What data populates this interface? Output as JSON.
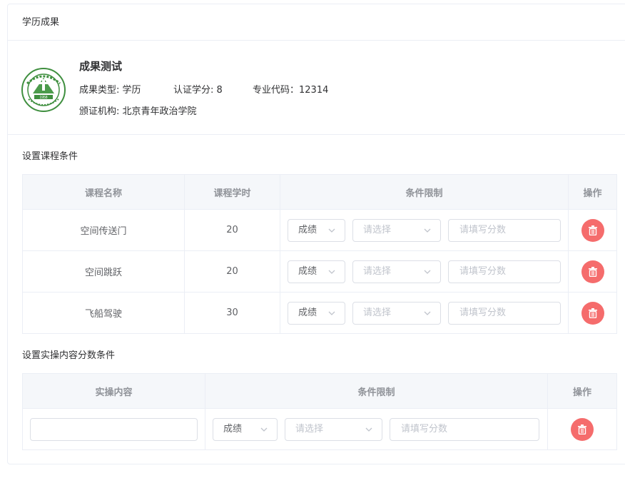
{
  "card": {
    "header": "学历成果"
  },
  "achievement": {
    "title": "成果测试",
    "type_label": "成果类型: 学历",
    "credits_label": "认证学分: 8",
    "major_code_label": "专业代码：12314",
    "issuer_label": "颁证机构: 北京青年政治学院",
    "logo_icon": "school-seal-logo",
    "logo_text": "1958"
  },
  "course_section": {
    "title": "设置课程条件",
    "columns": [
      "课程名称",
      "课程学时",
      "条件限制",
      "操作"
    ],
    "rows": [
      {
        "name": "空间传送门",
        "hours": "20",
        "condition_type": "成绩",
        "select_placeholder": "请选择",
        "score_placeholder": "请填写分数"
      },
      {
        "name": "空间跳跃",
        "hours": "20",
        "condition_type": "成绩",
        "select_placeholder": "请选择",
        "score_placeholder": "请填写分数"
      },
      {
        "name": "飞船驾驶",
        "hours": "30",
        "condition_type": "成绩",
        "select_placeholder": "请选择",
        "score_placeholder": "请填写分数"
      }
    ]
  },
  "practice_section": {
    "title": "设置实操内容分数条件",
    "columns": [
      "实操内容",
      "条件限制",
      "操作"
    ],
    "rows": [
      {
        "content_value": "",
        "condition_type": "成绩",
        "select_placeholder": "请选择",
        "score_placeholder": "请填写分数"
      }
    ]
  },
  "colors": {
    "danger": "#f56c6c",
    "border": "#ebeef5",
    "header_bg": "#f5f7fa"
  }
}
